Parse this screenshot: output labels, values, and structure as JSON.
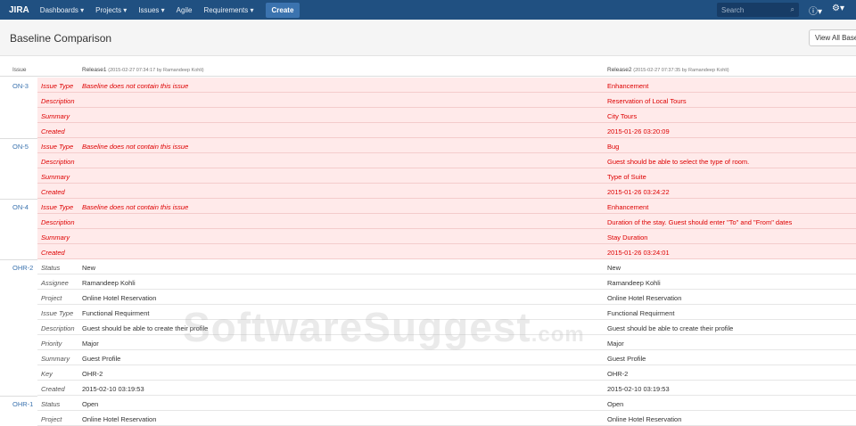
{
  "nav": {
    "logo": "JIRA",
    "items": [
      "Dashboards ▾",
      "Projects ▾",
      "Issues ▾",
      "Agile",
      "Requirements ▾"
    ],
    "create": "Create",
    "search_placeholder": "Search"
  },
  "page": {
    "title": "Baseline Comparison",
    "view_all": "View All Baselines"
  },
  "table": {
    "col_issue": "Issue",
    "release1": "Release1",
    "release1_meta": "(2015-02-27 07:34:17 by Ramandeep Kohli)",
    "release2": "Release2",
    "release2_meta": "(2015-02-27 07:37:35 by Ramandeep Kohli)"
  },
  "issues": [
    {
      "key": "ON-3",
      "changed": true,
      "rows": [
        [
          "Issue Type",
          "Baseline does not contain this issue",
          "Enhancement"
        ],
        [
          "Description",
          "",
          "Reservation of Local Tours"
        ],
        [
          "Summary",
          "",
          "City Tours"
        ],
        [
          "Created",
          "",
          "2015-01-26 03:20:09"
        ]
      ]
    },
    {
      "key": "ON-5",
      "changed": true,
      "rows": [
        [
          "Issue Type",
          "Baseline does not contain this issue",
          "Bug"
        ],
        [
          "Description",
          "",
          "Guest should be able to select the type of room."
        ],
        [
          "Summary",
          "",
          "Type of Suite"
        ],
        [
          "Created",
          "",
          "2015-01-26 03:24:22"
        ]
      ]
    },
    {
      "key": "ON-4",
      "changed": true,
      "rows": [
        [
          "Issue Type",
          "Baseline does not contain this issue",
          "Enhancement"
        ],
        [
          "Description",
          "",
          "Duration of the stay. Guest should enter \"To\" and \"From\" dates"
        ],
        [
          "Summary",
          "",
          "Stay Duration"
        ],
        [
          "Created",
          "",
          "2015-01-26 03:24:01"
        ]
      ]
    },
    {
      "key": "OHR-2",
      "changed": false,
      "rows": [
        [
          "Status",
          "New",
          "New"
        ],
        [
          "Assignee",
          "Ramandeep Kohli",
          "Ramandeep Kohli"
        ],
        [
          "Project",
          "Online Hotel Reservation",
          "Online Hotel Reservation"
        ],
        [
          "Issue Type",
          "Functional Requirment",
          "Functional Requirment"
        ],
        [
          "Description",
          "Guest should be able to create their profile",
          "Guest should be able to create their profile"
        ],
        [
          "Priority",
          "Major",
          "Major"
        ],
        [
          "Summary",
          "Guest Profile",
          "Guest Profile"
        ],
        [
          "Key",
          "OHR-2",
          "OHR-2"
        ],
        [
          "Created",
          "2015-02-10 03:19:53",
          "2015-02-10 03:19:53"
        ]
      ]
    },
    {
      "key": "OHR-1",
      "changed": false,
      "rows": [
        [
          "Status",
          "Open",
          "Open"
        ],
        [
          "Project",
          "Online Hotel Reservation",
          "Online Hotel Reservation"
        ]
      ]
    }
  ],
  "watermark": "SoftwareSuggest.com"
}
